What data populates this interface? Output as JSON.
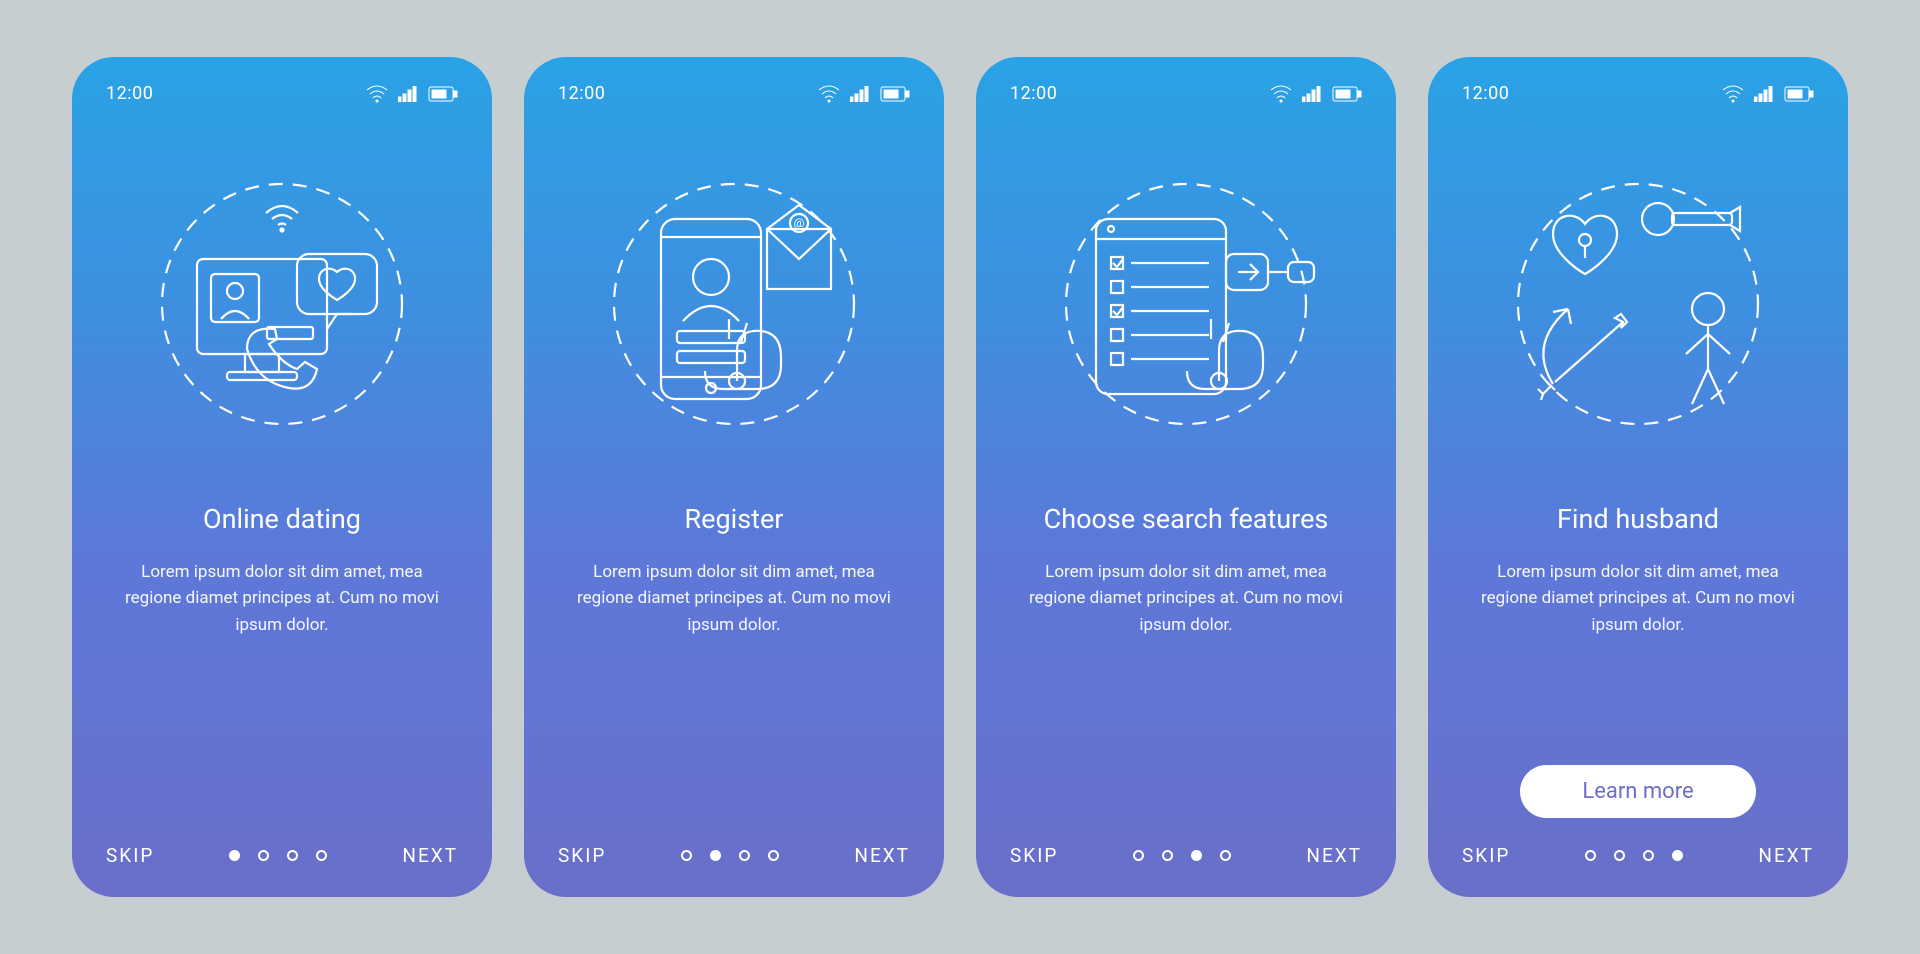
{
  "status": {
    "time": "12:00"
  },
  "common": {
    "skip": "SKIP",
    "next": "NEXT",
    "learn_more": "Learn more",
    "desc": "Lorem ipsum dolor sit dim amet, mea regione diamet principes at. Cum no movi ipsum dolor."
  },
  "screens": [
    {
      "title": "Online dating",
      "active_dot": 0,
      "has_button": false
    },
    {
      "title": "Register",
      "active_dot": 1,
      "has_button": false
    },
    {
      "title": "Choose search features",
      "active_dot": 2,
      "has_button": false
    },
    {
      "title": "Find husband",
      "active_dot": 3,
      "has_button": true
    }
  ]
}
